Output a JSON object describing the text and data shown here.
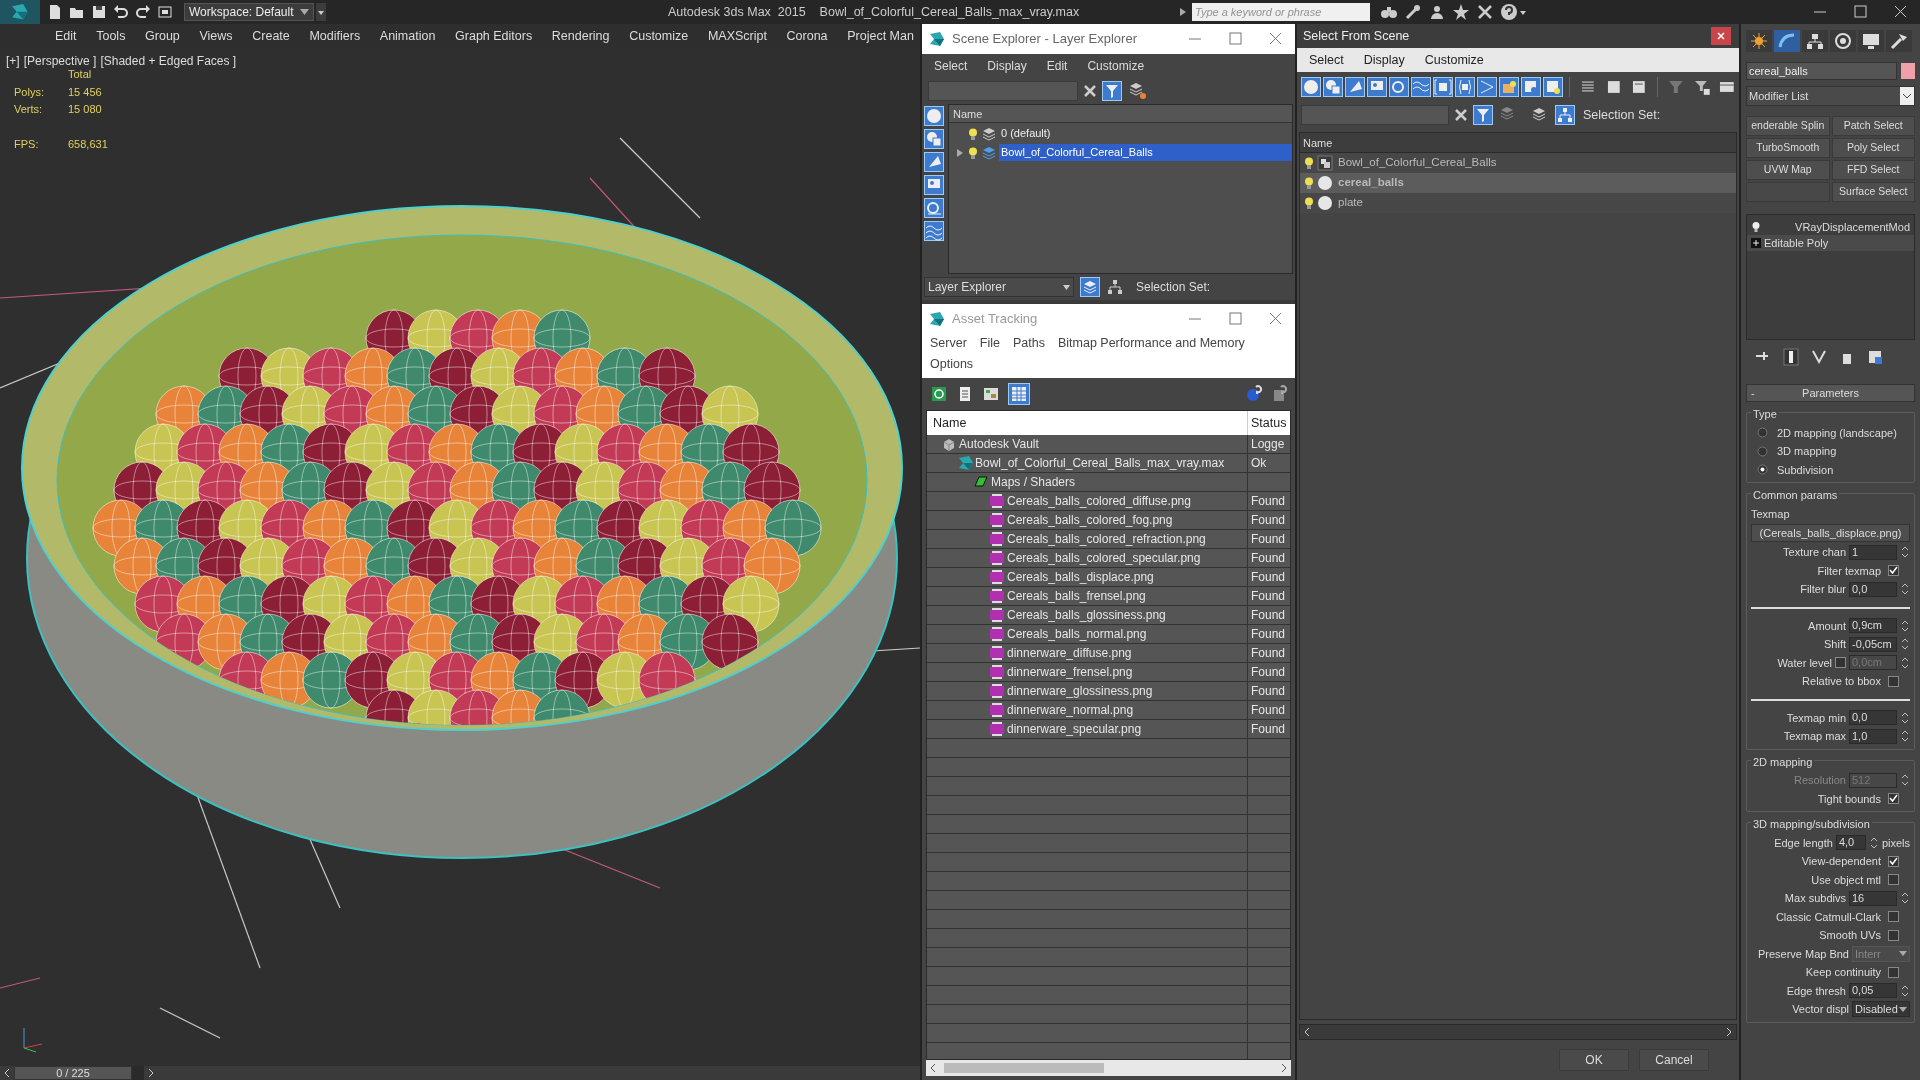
{
  "title_bar": {
    "workspace": "Workspace: Default",
    "app": "Autodesk 3ds Max  2015",
    "file": "Bowl_of_Colorful_Cereal_Balls_max_vray.max",
    "search": {
      "placeholder": "Type a keyword or phrase"
    }
  },
  "menu": [
    "Edit",
    "Tools",
    "Group",
    "Views",
    "Create",
    "Modifiers",
    "Animation",
    "Graph Editors",
    "Rendering",
    "Customize",
    "MAXScript",
    "Corona",
    "Project Man"
  ],
  "viewport": {
    "labels": [
      "[+]",
      "[Perspective ]",
      "[Shaded + Edged Faces ]"
    ],
    "stats_header": "Total",
    "stats": [
      {
        "label": "Polys:",
        "value": "15 456"
      },
      {
        "label": "Verts:",
        "value": "15 080"
      }
    ],
    "fps": {
      "label": "FPS:",
      "value": "658,631"
    }
  },
  "timeline": {
    "frame": "0 / 225",
    "level": 0
  },
  "scene_explorer": {
    "title": "Scene Explorer - Layer Explorer",
    "menu": [
      "Select",
      "Display",
      "Edit",
      "Customize"
    ],
    "column": "Name",
    "layers": [
      {
        "name": "0 (default)",
        "has_children": false,
        "selected": false
      },
      {
        "name": "Bowl_of_Colorful_Cereal_Balls",
        "has_children": true,
        "selected": true
      }
    ],
    "explorer_type": "Layer Explorer",
    "selection_set_label": "Selection Set:"
  },
  "asset_tracking": {
    "title": "Asset Tracking",
    "menu": [
      "Server",
      "File",
      "Paths",
      "Bitmap Performance and Memory",
      "Options"
    ],
    "columns": [
      "Name",
      "Status"
    ],
    "tree": [
      {
        "kind": "vault",
        "name": "Autodesk Vault",
        "status": "Logge",
        "children": [
          {
            "kind": "scene",
            "name": "Bowl_of_Colorful_Cereal_Balls_max_vray.max",
            "status": "Ok",
            "children": [
              {
                "kind": "folder",
                "name": "Maps / Shaders",
                "children": [
                  {
                    "kind": "png",
                    "name": "Cereals_balls_colored_diffuse.png",
                    "status": "Found"
                  },
                  {
                    "kind": "png",
                    "name": "Cereals_balls_colored_fog.png",
                    "status": "Found"
                  },
                  {
                    "kind": "png",
                    "name": "Cereals_balls_colored_refraction.png",
                    "status": "Found"
                  },
                  {
                    "kind": "png",
                    "name": "Cereals_balls_colored_specular.png",
                    "status": "Found"
                  },
                  {
                    "kind": "png",
                    "name": "Cereals_balls_displace.png",
                    "status": "Found"
                  },
                  {
                    "kind": "png",
                    "name": "Cereals_balls_frensel.png",
                    "status": "Found"
                  },
                  {
                    "kind": "png",
                    "name": "Cereals_balls_glossiness.png",
                    "status": "Found"
                  },
                  {
                    "kind": "png",
                    "name": "Cereals_balls_normal.png",
                    "status": "Found"
                  },
                  {
                    "kind": "png",
                    "name": "dinnerware_diffuse.png",
                    "status": "Found"
                  },
                  {
                    "kind": "png",
                    "name": "dinnerware_frensel.png",
                    "status": "Found"
                  },
                  {
                    "kind": "png",
                    "name": "dinnerware_glossiness.png",
                    "status": "Found"
                  },
                  {
                    "kind": "png",
                    "name": "dinnerware_normal.png",
                    "status": "Found"
                  },
                  {
                    "kind": "png",
                    "name": "dinnerware_specular.png",
                    "status": "Found"
                  }
                ]
              }
            ]
          }
        ]
      }
    ]
  },
  "select_from_scene": {
    "title": "Select From Scene",
    "menu": [
      "Select",
      "Display",
      "Customize"
    ],
    "selection_set_label": "Selection Set:",
    "column": "Name",
    "objects": [
      {
        "kind": "group",
        "name": "Bowl_of_Colorful_Cereal_Balls",
        "selected": false
      },
      {
        "kind": "geometry",
        "name": "cereal_balls",
        "selected": true
      },
      {
        "kind": "geometry",
        "name": "plate",
        "selected": false
      }
    ],
    "buttons": [
      "OK",
      "Cancel"
    ]
  },
  "command_panel": {
    "object_name": "cereal_balls",
    "modifier_list": "Modifier List",
    "modifier_buttons": [
      {
        "kind": "button",
        "label": "enderable Splin"
      },
      {
        "kind": "button",
        "label": "Patch Select"
      },
      {
        "kind": "button",
        "label": "TurboSmooth"
      },
      {
        "kind": "button",
        "label": "Poly Select"
      },
      {
        "kind": "button",
        "label": "UVW Map"
      },
      {
        "kind": "button",
        "label": "FFD Select"
      },
      {
        "kind": "empty"
      },
      {
        "kind": "button",
        "label": "Surface Select"
      }
    ],
    "stack": [
      {
        "kind": "modifier",
        "name": "VRayDisplacementMod"
      },
      {
        "kind": "base",
        "name": "Editable Poly"
      }
    ],
    "rollout": {
      "toggle": "-",
      "title": "Parameters",
      "groups": [
        {
          "title": "Type",
          "rows": [
            {
              "kind": "radio",
              "label": "2D mapping (landscape)",
              "selected": false
            },
            {
              "kind": "radio",
              "label": "3D mapping",
              "selected": false
            },
            {
              "kind": "radio",
              "label": "Subdivision",
              "selected": true
            }
          ]
        },
        {
          "title": "Common params",
          "rows": [
            {
              "kind": "label",
              "label": "Texmap"
            },
            {
              "kind": "map_button",
              "label": "(Cereals_balls_displace.png)"
            },
            {
              "kind": "spinner",
              "label": "Texture chan",
              "value": "1",
              "disabled": false
            },
            {
              "kind": "checkbox",
              "label": "Filter texmap",
              "checked": true
            },
            {
              "kind": "spinner",
              "label": "Filter blur",
              "value": "0,0",
              "disabled": false
            },
            {
              "kind": "separator"
            },
            {
              "kind": "spinner",
              "label": "Amount",
              "value": "0,9cm",
              "disabled": false
            },
            {
              "kind": "spinner",
              "label": "Shift",
              "value": "-0,05cm",
              "disabled": false
            },
            {
              "kind": "check_spinner",
              "label": "Water level",
              "checked": false,
              "value": "0,0cm",
              "disabled": true
            },
            {
              "kind": "checkbox",
              "label": "Relative to bbox",
              "checked": false
            },
            {
              "kind": "separator"
            },
            {
              "kind": "spinner",
              "label": "Texmap min",
              "value": "0,0",
              "disabled": false
            },
            {
              "kind": "spinner",
              "label": "Texmap max",
              "value": "1,0",
              "disabled": false
            }
          ]
        },
        {
          "title": "2D mapping",
          "rows": [
            {
              "kind": "spinner",
              "label": "Resolution",
              "value": "512",
              "disabled": true
            },
            {
              "kind": "checkbox",
              "label": "Tight bounds",
              "checked": true
            }
          ]
        },
        {
          "title": "3D mapping/subdivision",
          "rows": [
            {
              "kind": "spinner",
              "label": "Edge length",
              "value": "4,0",
              "unit": "pixels",
              "disabled": false
            },
            {
              "kind": "checkbox",
              "label": "View-dependent",
              "checked": true
            },
            {
              "kind": "checkbox",
              "label": "Use object mtl",
              "checked": false
            },
            {
              "kind": "spinner",
              "label": "Max subdivs",
              "value": "16",
              "disabled": false
            },
            {
              "kind": "checkbox",
              "label": "Classic Catmull-Clark",
              "checked": false
            },
            {
              "kind": "checkbox",
              "label": "Smooth UVs",
              "checked": false
            },
            {
              "kind": "dropdown",
              "label": "Preserve Map Bnd",
              "value": "Interr",
              "disabled": true
            },
            {
              "kind": "checkbox",
              "label": "Keep continuity",
              "checked": false
            },
            {
              "kind": "spinner",
              "label": "Edge thresh",
              "value": "0,05",
              "disabled": false
            },
            {
              "kind": "dropdown",
              "label": "Vector displ",
              "value": "Disabled",
              "disabled": false
            }
          ]
        }
      ]
    }
  }
}
